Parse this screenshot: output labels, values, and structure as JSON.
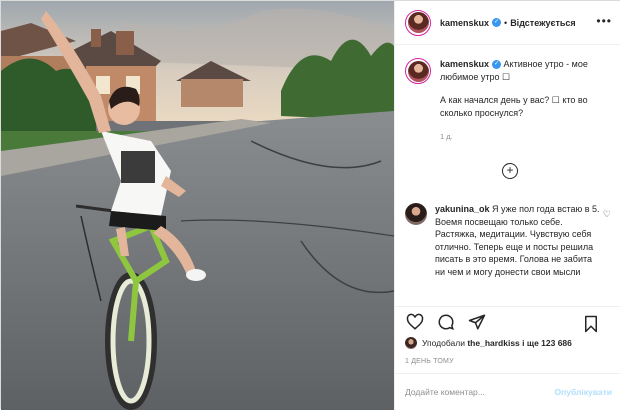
{
  "post": {
    "username": "kamenskux",
    "follow_label": "Відстежується",
    "more_icon": "more-horizontal-icon",
    "caption": {
      "username": "kamenskux",
      "text": "Активное утро - мое любимое утро ☐",
      "question": "А как начался день у вас? ☐ кто во сколько проснулся?",
      "time": "1 д."
    },
    "load_more_icon": "plus-circle-icon",
    "comment": {
      "username": "yakunina_ok",
      "text": "Я уже пол года встаю в 5. Воемя посвещаю только себе. Растяжка, медитации. Чувствую себя отлично. Теперь еще и посты решила писать в это время. Голова не забита ни чем и могу донести свои мысли"
    },
    "actions": {
      "like_icon": "heart-icon",
      "comment_icon": "comment-icon",
      "share_icon": "paper-plane-icon",
      "save_icon": "bookmark-icon"
    },
    "likes": {
      "prefix": "Уподобали",
      "user": "the_hardkiss",
      "suffix": "і ще 123 686"
    },
    "posted_ago": "1 день тому",
    "add_comment": {
      "placeholder": "Додайте коментар...",
      "publish_label": "Опублікувати"
    }
  },
  "colors": {
    "verified": "#3897f0",
    "story_ring": "#d6249f",
    "secondary_text": "#8e8e8e",
    "publish_disabled": "#b2dffc"
  }
}
